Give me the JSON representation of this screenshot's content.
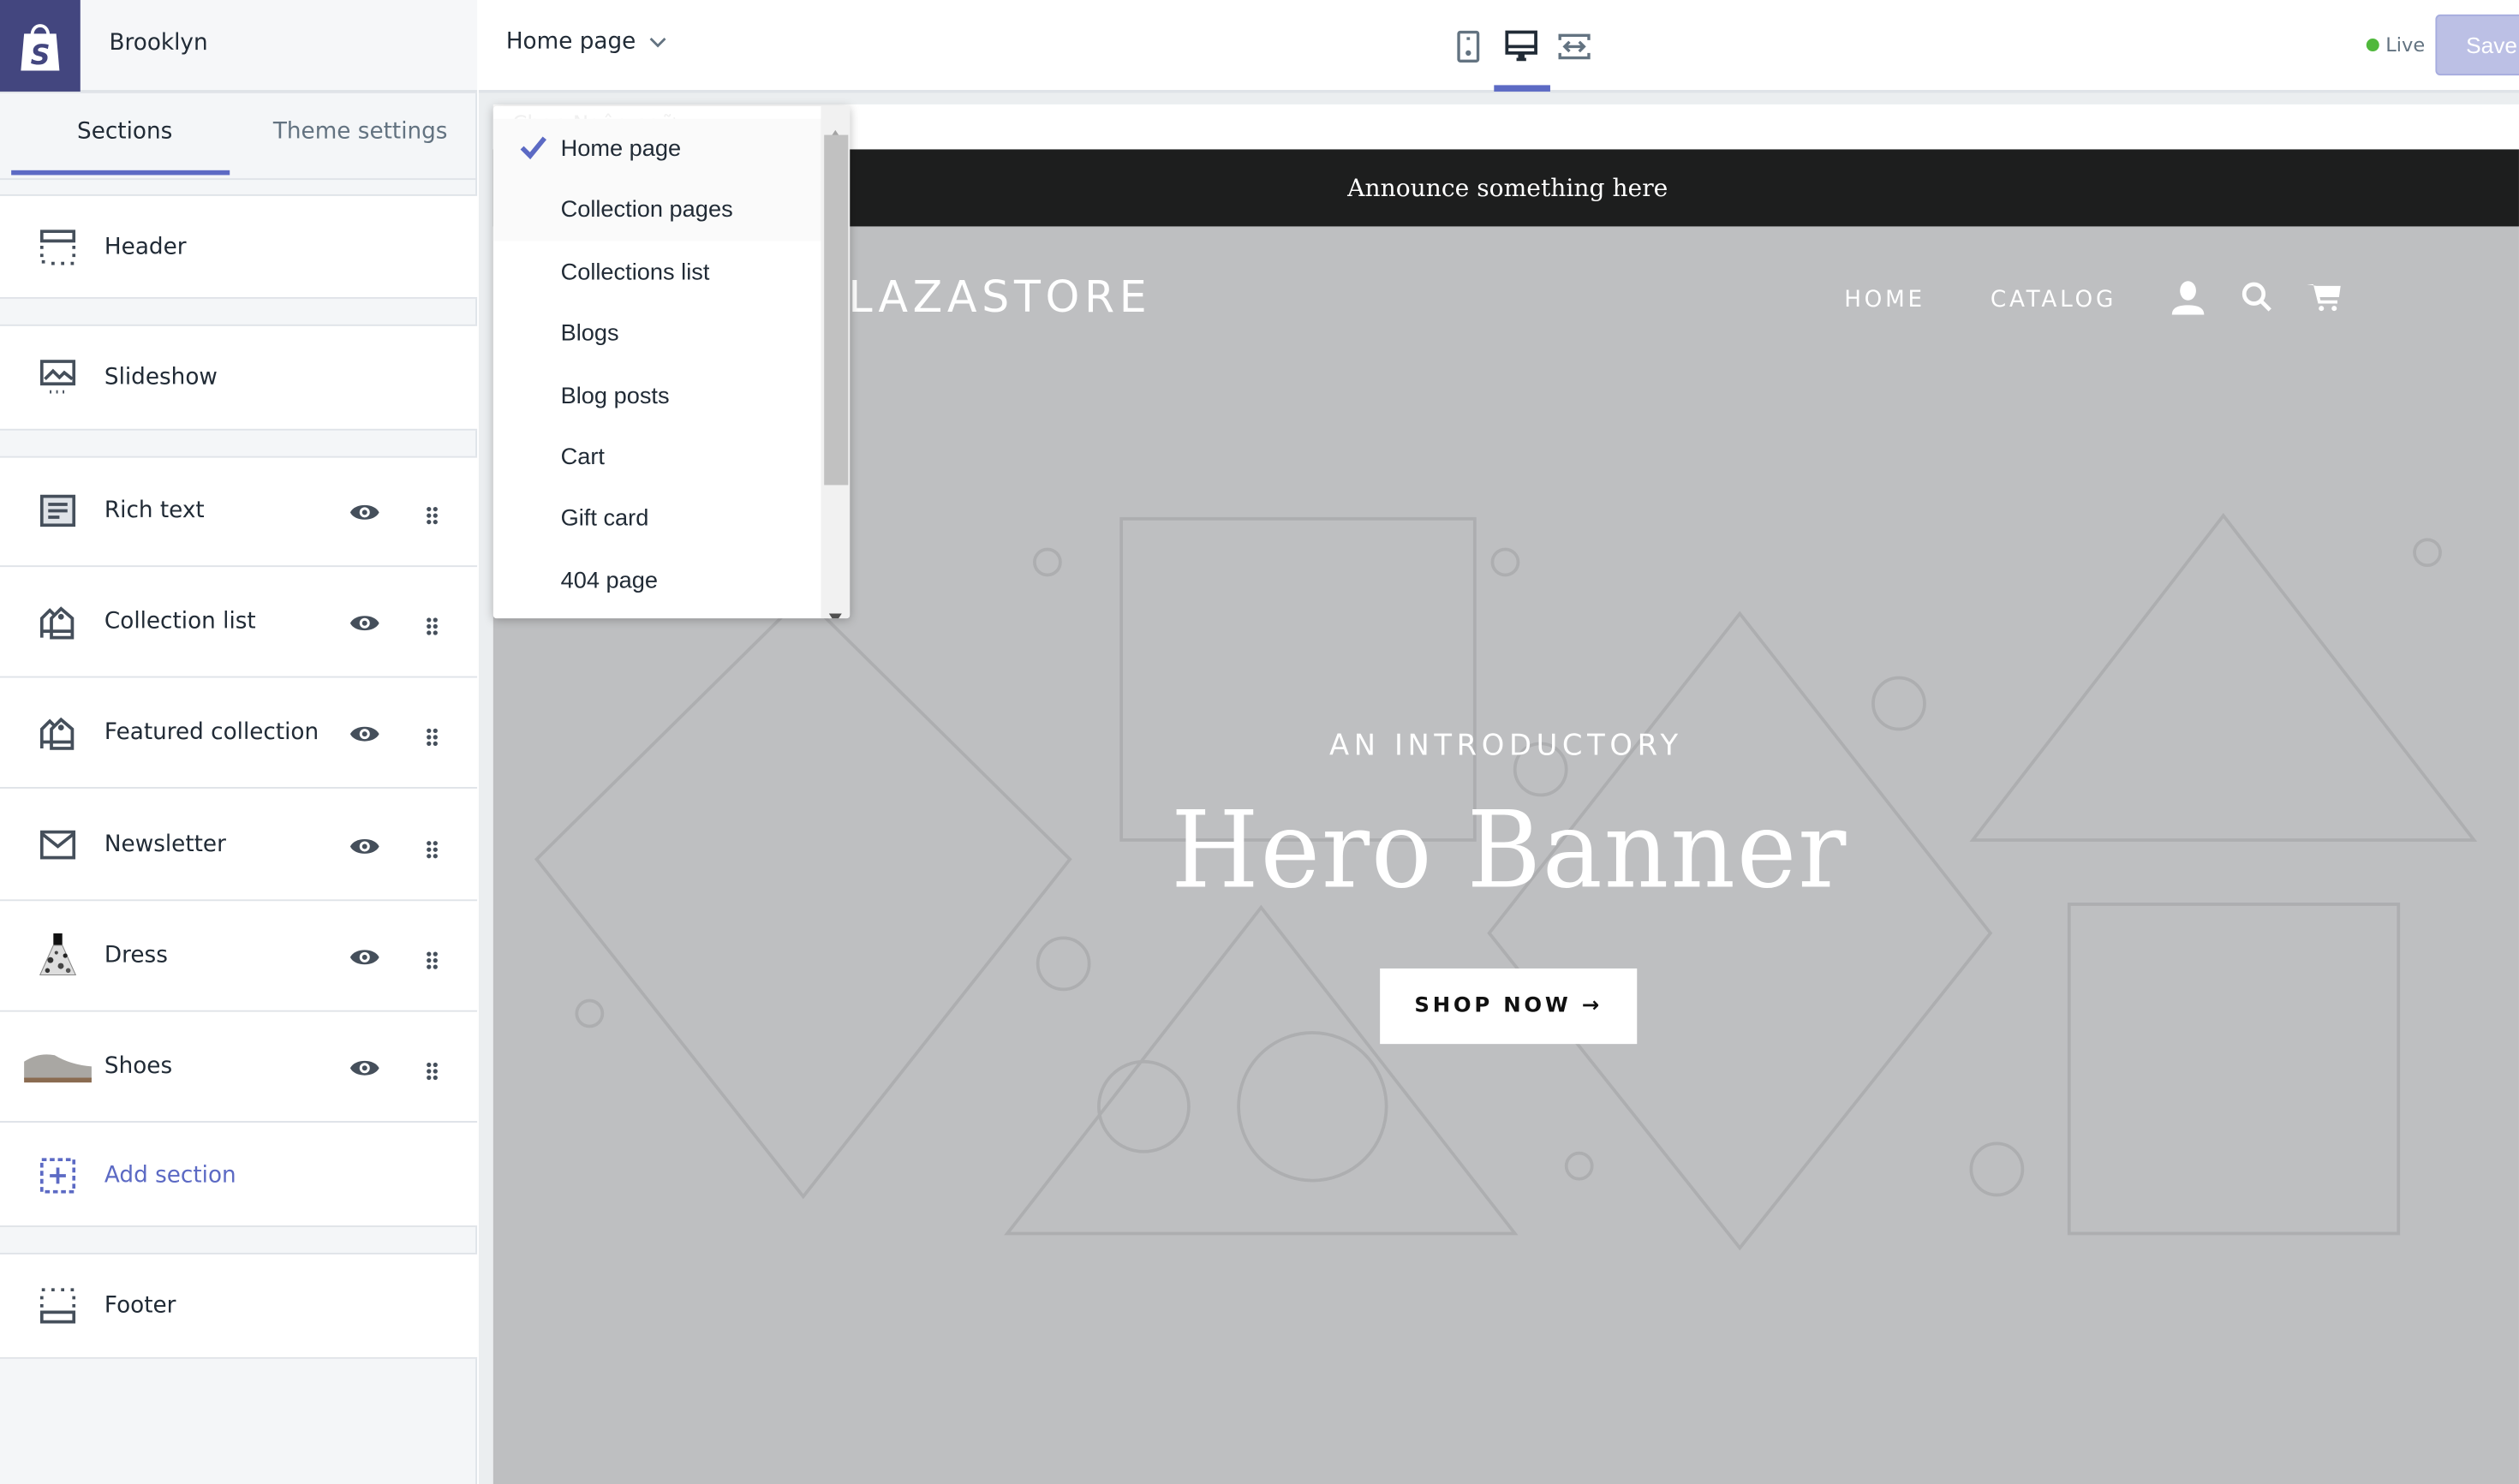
{
  "sidebar": {
    "theme_name": "Brooklyn",
    "tabs": [
      {
        "label": "Sections",
        "active": true
      },
      {
        "label": "Theme settings",
        "active": false
      }
    ],
    "header_item": {
      "label": "Header",
      "icon": "header-layout-icon"
    },
    "slideshow_item": {
      "label": "Slideshow",
      "icon": "slideshow-icon"
    },
    "sections": [
      {
        "label": "Rich text",
        "icon": "text-block-icon"
      },
      {
        "label": "Collection list",
        "icon": "collection-icon"
      },
      {
        "label": "Featured collection",
        "icon": "collection-icon"
      },
      {
        "label": "Newsletter",
        "icon": "envelope-icon"
      },
      {
        "label": "Dress",
        "icon": "dress-thumbnail"
      },
      {
        "label": "Shoes",
        "icon": "shoe-thumbnail"
      }
    ],
    "add_section": "Add section",
    "footer_item": {
      "label": "Footer",
      "icon": "footer-layout-icon"
    }
  },
  "topbar": {
    "page_selector": "Home page",
    "devices": [
      "mobile",
      "desktop",
      "full-width"
    ],
    "active_device": "desktop",
    "status": "Live",
    "save_label": "Save"
  },
  "dropdown": {
    "ghost_text": "Chọn Ngôn ngữ",
    "options": [
      "Home page",
      "Collection pages",
      "Collections list",
      "Blogs",
      "Blog posts",
      "Cart",
      "Gift card",
      "404 page"
    ],
    "selected": "Home page"
  },
  "preview": {
    "announcement": "Announce something here",
    "store_logo": "LAZASTORE",
    "nav": [
      "HOME",
      "CATALOG"
    ],
    "hero_subtitle": "AN INTRODUCTORY",
    "hero_title": "Hero Banner",
    "hero_button": "SHOP NOW →"
  },
  "colors": {
    "accent": "#5c6ac4",
    "brand": "#43467f",
    "live": "#50b83c",
    "save": "#bcc0e5",
    "announcement_bg": "#1d1e1e",
    "hero_bg": "#bebfc1"
  }
}
